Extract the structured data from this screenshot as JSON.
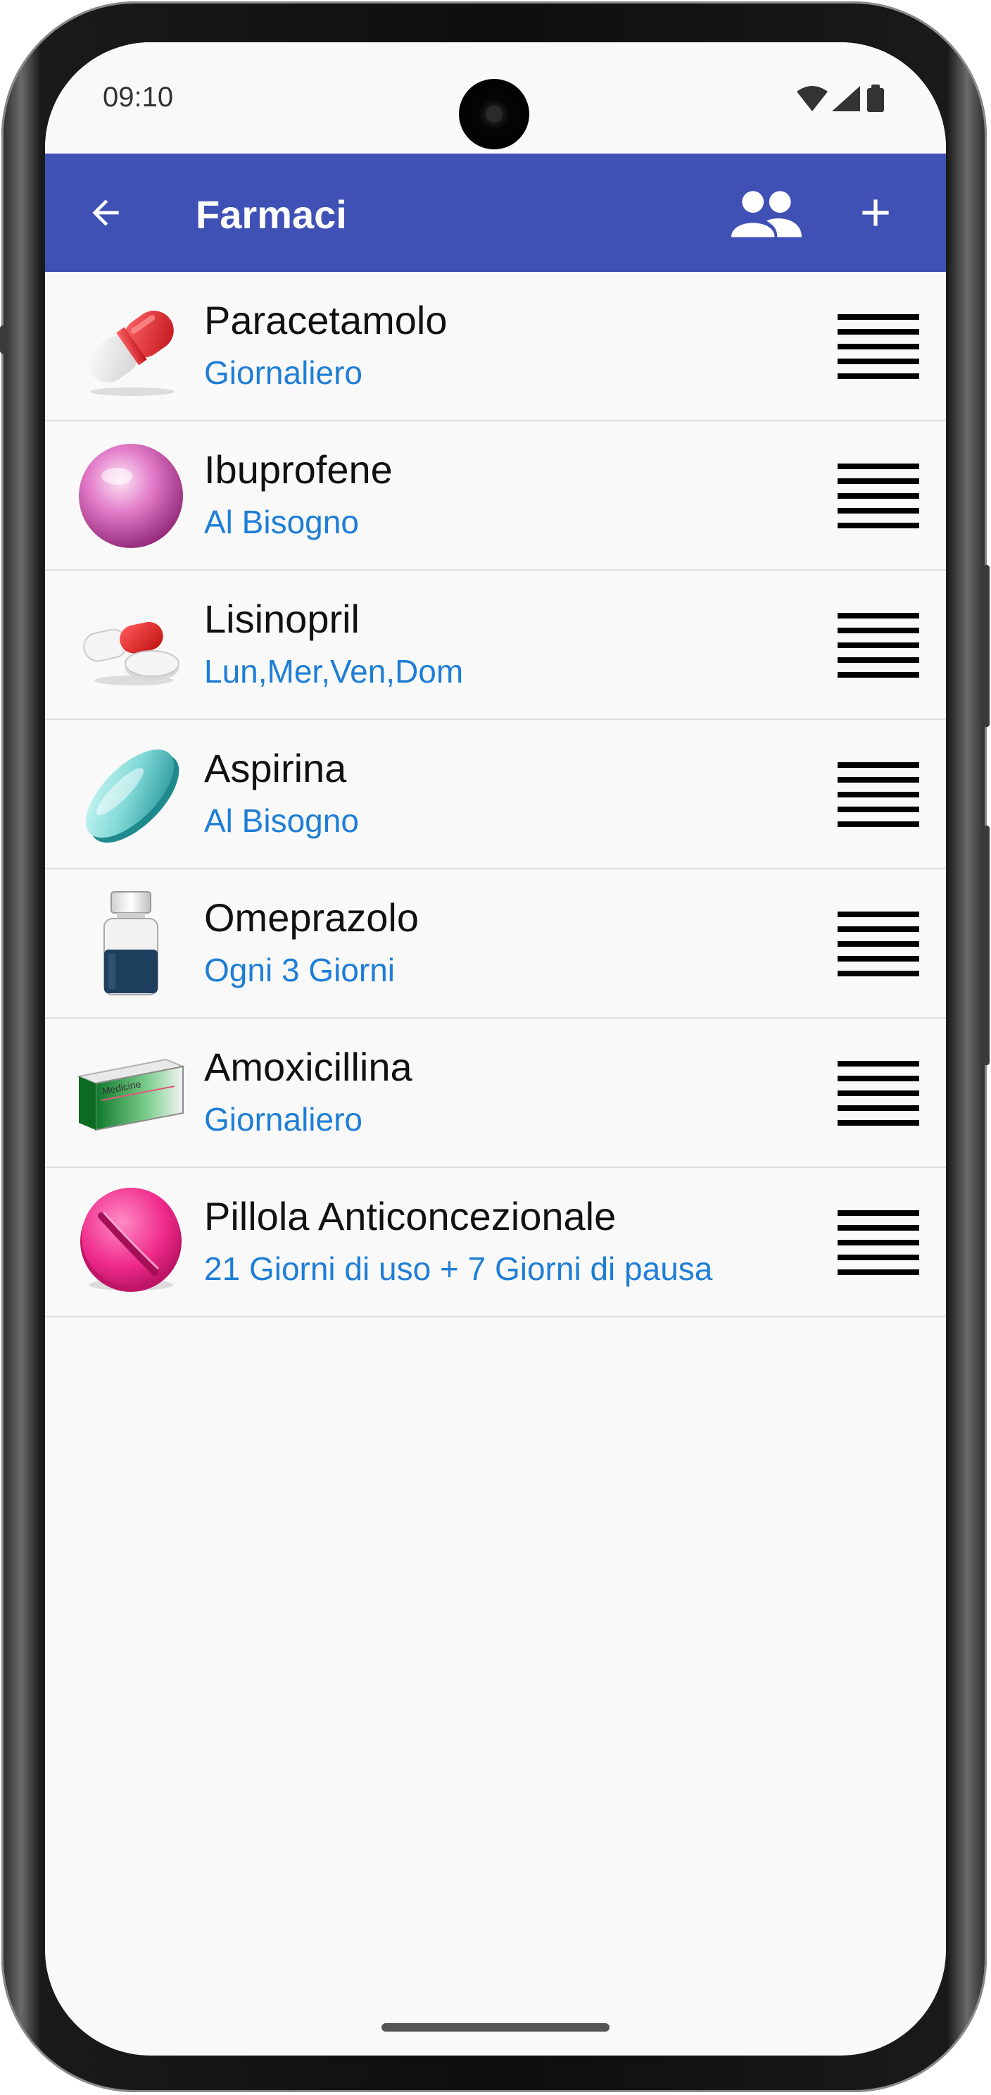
{
  "status": {
    "time": "09:10"
  },
  "app_bar": {
    "title": "Farmaci"
  },
  "icons": {
    "back": "arrow-back-icon",
    "people": "people-icon",
    "add": "plus-icon",
    "drag": "drag-handle-icon",
    "wifi": "wifi-icon",
    "signal": "signal-icon",
    "battery": "battery-icon"
  },
  "colors": {
    "app_bar": "#3f51b5",
    "schedule_text": "#1e7ed6",
    "background": "#f9f9f9"
  },
  "medicines": [
    {
      "name": "Paracetamolo",
      "schedule": "Giornaliero",
      "icon": "capsule-red-white-icon"
    },
    {
      "name": "Ibuprofene",
      "schedule": "Al Bisogno",
      "icon": "pink-pearl-pill-icon"
    },
    {
      "name": "Lisinopril",
      "schedule": "Lun,Mer,Ven,Dom",
      "icon": "capsule-and-tablet-icon"
    },
    {
      "name": "Aspirina",
      "schedule": "Al Bisogno",
      "icon": "teal-oval-tablet-icon"
    },
    {
      "name": "Omeprazolo",
      "schedule": "Ogni 3 Giorni",
      "icon": "medicine-bottle-icon"
    },
    {
      "name": "Amoxicillina",
      "schedule": "Giornaliero",
      "icon": "medicine-box-icon",
      "box_label": "Medicine"
    },
    {
      "name": "Pillola Anticoncezionale",
      "schedule": "21 Giorni di uso + 7 Giorni di pausa",
      "icon": "pink-round-tablet-icon"
    }
  ]
}
